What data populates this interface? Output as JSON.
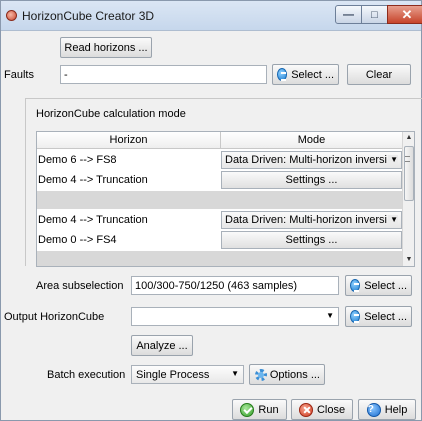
{
  "window": {
    "title": "HorizonCube Creator 3D"
  },
  "read_horizons_label": "Read horizons ...",
  "faults": {
    "label": "Faults",
    "value": "-",
    "select_label": "Select ...",
    "clear_label": "Clear"
  },
  "calc_mode": {
    "group_label": "HorizonCube calculation mode",
    "columns": [
      "Horizon",
      "Mode"
    ],
    "rows": [
      {
        "horizon": "Demo 6 --> FS8",
        "mode": "Data Driven: Multi-horizon inversi",
        "kind": "combo"
      },
      {
        "horizon": "Demo 4 --> Truncation",
        "mode": "Settings ...",
        "kind": "button"
      },
      {
        "horizon": "Demo 4 --> Truncation",
        "mode": "Data Driven: Multi-horizon inversi",
        "kind": "combo"
      },
      {
        "horizon": "Demo 0 --> FS4",
        "mode": "Settings ...",
        "kind": "button"
      }
    ]
  },
  "area": {
    "label": "Area subselection",
    "value": "100/300-750/1250 (463 samples)",
    "select_label": "Select ..."
  },
  "output": {
    "label": "Output HorizonCube",
    "value": "",
    "select_label": "Select ..."
  },
  "analyze_label": "Analyze ...",
  "batch": {
    "label": "Batch execution",
    "value": "Single Process",
    "options_label": "Options ..."
  },
  "footer": {
    "run_label": "Run",
    "close_label": "Close",
    "help_label": "Help"
  },
  "icons": {
    "select": "blue-list-circle-icon",
    "run": "green-check-circle-icon",
    "close": "red-x-circle-icon",
    "help": "blue-question-circle-icon",
    "options": "gear-icon"
  }
}
